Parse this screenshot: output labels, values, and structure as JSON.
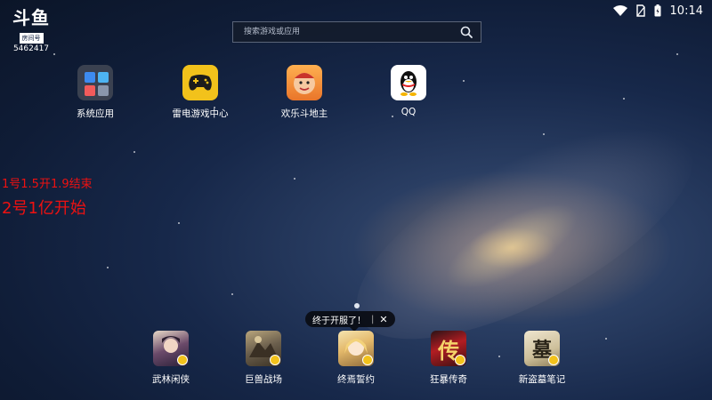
{
  "status_bar": {
    "time": "10:14"
  },
  "logo": {
    "mark": "斗鱼",
    "room_label": "房间号",
    "room_number": "5462417"
  },
  "search": {
    "placeholder": "搜索游戏或应用"
  },
  "apps": [
    {
      "label": "系统应用",
      "icon": "system-apps-icon"
    },
    {
      "label": "雷电游戏中心",
      "icon": "leidian-game-center-icon"
    },
    {
      "label": "欢乐斗地主",
      "icon": "doudizhu-icon"
    },
    {
      "label": "QQ",
      "icon": "qq-penguin-icon"
    }
  ],
  "overlay": {
    "line1": "1号1.5开1.9结束",
    "line2": "2号1亿开始"
  },
  "tooltip": {
    "text": "终于开服了！",
    "sep": "|",
    "close": "✕"
  },
  "dock": [
    {
      "label": "武林闲侠",
      "icon": "wulin-xianxia-icon"
    },
    {
      "label": "巨兽战场",
      "icon": "jushou-zhanchang-icon"
    },
    {
      "label": "终焉誓约",
      "icon": "zhongyan-shiyue-icon"
    },
    {
      "label": "狂暴传奇",
      "icon": "kuangbao-chuanqi-icon",
      "glyph": "传"
    },
    {
      "label": "新盗墓笔记",
      "icon": "daomu-biji-icon",
      "glyph": "墓"
    }
  ],
  "colors": {
    "overlay_text": "#e11111",
    "leidian_yellow": "#f2c21b"
  }
}
